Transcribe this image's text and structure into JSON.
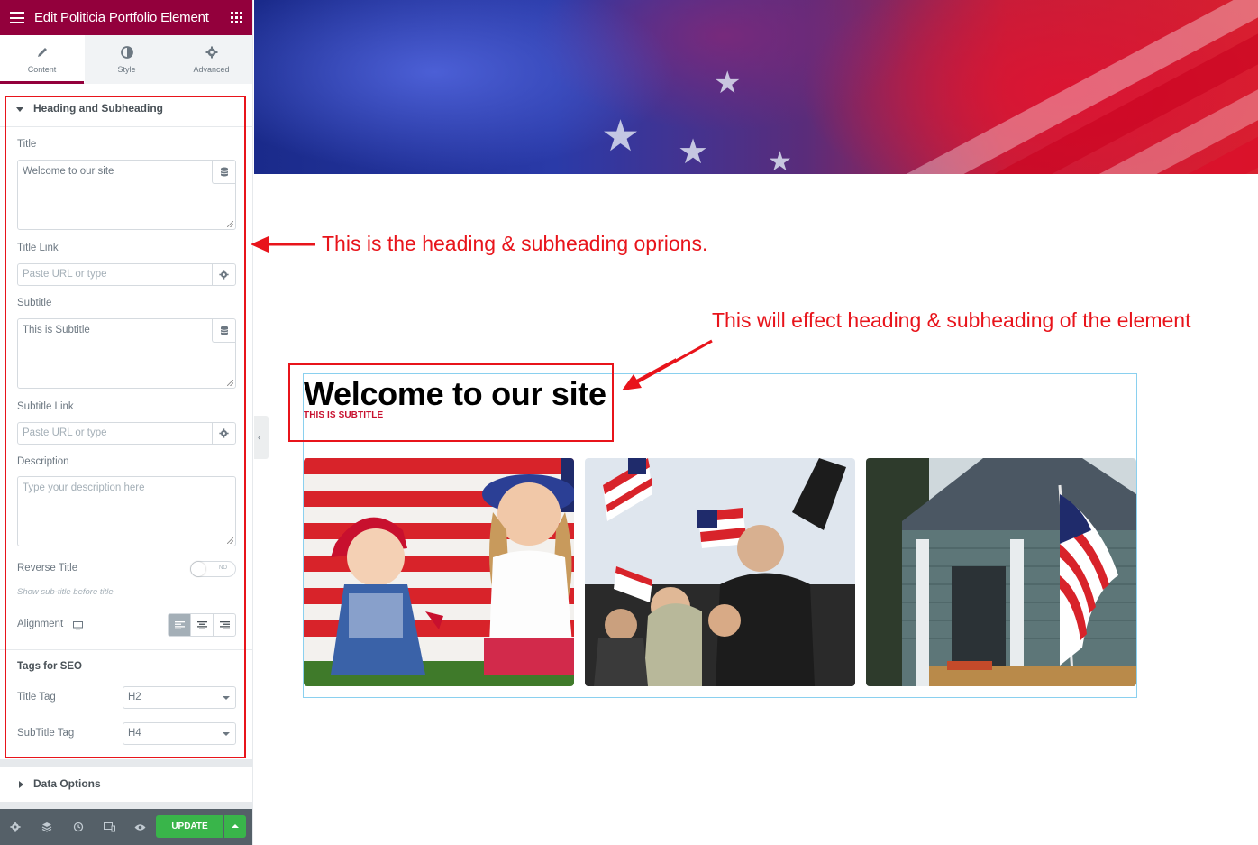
{
  "topbar": {
    "title": "Edit Politicia Portfolio Element"
  },
  "tabs": [
    {
      "label": "Content"
    },
    {
      "label": "Style"
    },
    {
      "label": "Advanced"
    }
  ],
  "section_heading": {
    "title": "Heading and Subheading",
    "title_label": "Title",
    "title_value": "Welcome to our site",
    "title_link_label": "Title Link",
    "title_link_placeholder": "Paste URL or type",
    "subtitle_label": "Subtitle",
    "subtitle_value": "This is Subtitle",
    "subtitle_link_label": "Subtitle Link",
    "subtitle_link_placeholder": "Paste URL or type",
    "description_label": "Description",
    "description_placeholder": "Type your description here",
    "reverse_title_label": "Reverse Title",
    "reverse_title_toggle": "NO",
    "reverse_title_hint": "Show sub-title before title",
    "alignment_label": "Alignment",
    "seo_heading": "Tags for SEO",
    "title_tag_label": "Title Tag",
    "title_tag_value": "H2",
    "subtitle_tag_label": "SubTitle Tag",
    "subtitle_tag_value": "H4"
  },
  "section_data": {
    "title": "Data Options"
  },
  "footer": {
    "update_label": "UPDATE"
  },
  "canvas": {
    "heading": "Welcome to our site",
    "subheading": "THIS IS SUBTITLE"
  },
  "annotations": {
    "note1": "This is the heading & subheading oprions.",
    "note2": "This will effect heading & subheading of the element"
  },
  "colors": {
    "brand": "#93003c",
    "update": "#39b54a",
    "annotation": "#e8141b",
    "subtitle": "#c8102e"
  }
}
